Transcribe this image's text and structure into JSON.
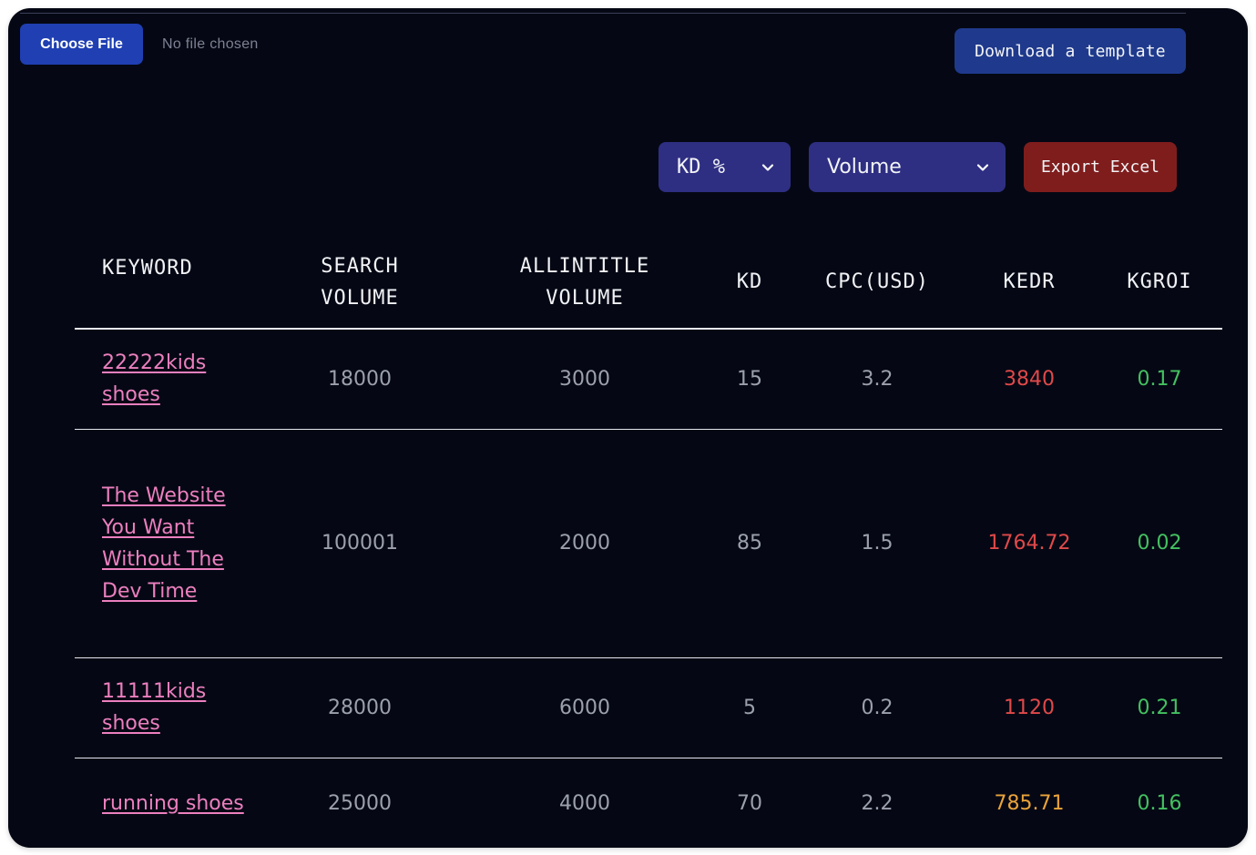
{
  "upload": {
    "choose_file_label": "Choose File",
    "file_status": "No file chosen",
    "download_template_label": "Download a template"
  },
  "controls": {
    "kd_select": {
      "selected": "KD %",
      "icon": "chevron-down-icon"
    },
    "sort_select": {
      "selected": "Volume",
      "icon": "chevron-down-icon"
    },
    "export_label": "Export Excel"
  },
  "colors": {
    "background": "#050814",
    "choose_file_bg": "#1f3fb2",
    "download_bg": "#1f3a8c",
    "select_bg": "#2e2f82",
    "export_bg": "#7f1d1d",
    "keyword_link": "#ec7fbf",
    "kedr_high": "#e0494a",
    "kedr_mid": "#eaa33a",
    "kgroi": "#44c061"
  },
  "table": {
    "headers": {
      "keyword": "KEYWORD",
      "search_volume_1": "SEARCH",
      "search_volume_2": "VOLUME",
      "allintitle_volume_1": "ALLINTITLE",
      "allintitle_volume_2": "VOLUME",
      "kd": "KD",
      "cpc": "CPC(USD)",
      "kedr": "KEDR",
      "kgroi": "KGROI"
    },
    "rows": [
      {
        "keyword": "22222kids shoes",
        "search_volume": "18000",
        "allintitle_volume": "3000",
        "kd": "15",
        "cpc": "3.2",
        "kedr": "3840",
        "kedr_level": "red",
        "kgroi": "0.17"
      },
      {
        "keyword": "The Website You Want Without The Dev Time",
        "search_volume": "100001",
        "allintitle_volume": "2000",
        "kd": "85",
        "cpc": "1.5",
        "kedr": "1764.72",
        "kedr_level": "red",
        "kgroi": "0.02"
      },
      {
        "keyword": "11111kids shoes",
        "search_volume": "28000",
        "allintitle_volume": "6000",
        "kd": "5",
        "cpc": "0.2",
        "kedr": "1120",
        "kedr_level": "red",
        "kgroi": "0.21"
      },
      {
        "keyword": "running shoes",
        "search_volume": "25000",
        "allintitle_volume": "4000",
        "kd": "70",
        "cpc": "2.2",
        "kedr": "785.71",
        "kedr_level": "orange",
        "kgroi": "0.16"
      }
    ]
  }
}
